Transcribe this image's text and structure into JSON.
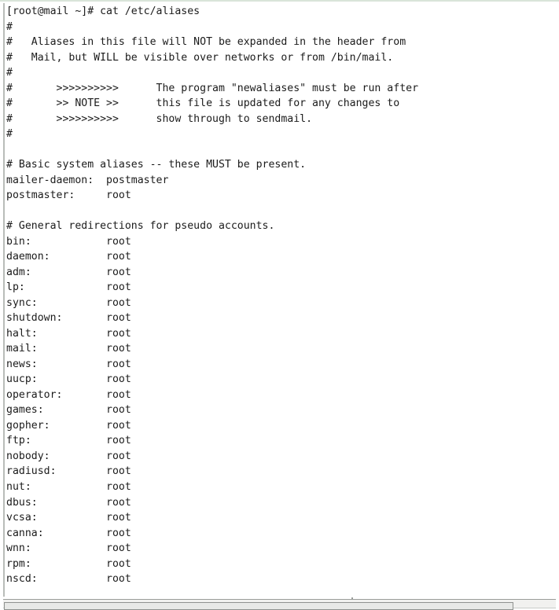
{
  "window": {
    "kind": "terminal-emulator",
    "background_color": "#ffffff",
    "foreground_color": "#1b1b1b",
    "border_color": "#b9bcb9",
    "top_border_color": "#d9e4d9"
  },
  "prompt": {
    "user": "root",
    "host": "mail",
    "cwd": "~",
    "symbol": "#",
    "full_prompt": "[root@mail ~]#",
    "command": "cat /etc/aliases",
    "full_line": "[root@mail ~]# cat /etc/aliases"
  },
  "file": {
    "path": "/etc/aliases",
    "alias_target_column": 16
  },
  "lines": [
    "[root@mail ~]# cat /etc/aliases",
    "#",
    "#   Aliases in this file will NOT be expanded in the header from",
    "#   Mail, but WILL be visible over networks or from /bin/mail.",
    "#",
    "#       >>>>>>>>>>      The program \"newaliases\" must be run after",
    "#       >> NOTE >>      this file is updated for any changes to",
    "#       >>>>>>>>>>      show through to sendmail.",
    "#",
    "",
    "# Basic system aliases -- these MUST be present.",
    "mailer-daemon:  postmaster",
    "postmaster:     root",
    "",
    "# General redirections for pseudo accounts.",
    "bin:            root",
    "daemon:         root",
    "adm:            root",
    "lp:             root",
    "sync:           root",
    "shutdown:       root",
    "halt:           root",
    "mail:           root",
    "news:           root",
    "uucp:           root",
    "operator:       root",
    "games:          root",
    "gopher:         root",
    "ftp:            root",
    "nobody:         root",
    "radiusd:        root",
    "nut:            root",
    "dbus:           root",
    "vcsa:           root",
    "canna:          root",
    "wnn:            root",
    "rpm:            root",
    "nscd:           root"
  ],
  "comments": {
    "header_block": [
      "Aliases in this file will NOT be expanded in the header from",
      "Mail, but WILL be visible over networks or from /bin/mail."
    ],
    "note_block": {
      "chevrons_top": ">>>>>>>>>>",
      "note_label": ">> NOTE >>",
      "chevrons_bottom": ">>>>>>>>>>",
      "text": [
        "The program \"newaliases\" must be run after",
        "this file is updated for any changes to",
        "show through to sendmail."
      ]
    },
    "basic_section": "# Basic system aliases -- these MUST be present.",
    "general_section": "# General redirections for pseudo accounts."
  },
  "aliases": [
    {
      "name": "mailer-daemon:",
      "target": "postmaster"
    },
    {
      "name": "postmaster:",
      "target": "root"
    },
    {
      "name": "bin:",
      "target": "root"
    },
    {
      "name": "daemon:",
      "target": "root"
    },
    {
      "name": "adm:",
      "target": "root"
    },
    {
      "name": "lp:",
      "target": "root"
    },
    {
      "name": "sync:",
      "target": "root"
    },
    {
      "name": "shutdown:",
      "target": "root"
    },
    {
      "name": "halt:",
      "target": "root"
    },
    {
      "name": "mail:",
      "target": "root"
    },
    {
      "name": "news:",
      "target": "root"
    },
    {
      "name": "uucp:",
      "target": "root"
    },
    {
      "name": "operator:",
      "target": "root"
    },
    {
      "name": "games:",
      "target": "root"
    },
    {
      "name": "gopher:",
      "target": "root"
    },
    {
      "name": "ftp:",
      "target": "root"
    },
    {
      "name": "nobody:",
      "target": "root"
    },
    {
      "name": "radiusd:",
      "target": "root"
    },
    {
      "name": "nut:",
      "target": "root"
    },
    {
      "name": "dbus:",
      "target": "root"
    },
    {
      "name": "vcsa:",
      "target": "root"
    },
    {
      "name": "canna:",
      "target": "root"
    },
    {
      "name": "wnn:",
      "target": "root"
    },
    {
      "name": "rpm:",
      "target": "root"
    },
    {
      "name": "nscd:",
      "target": "root"
    }
  ],
  "scrollbar": {
    "orientation": "horizontal",
    "thumb_color": "#e8e9e7",
    "trough_color": "#f1f1ef",
    "thumb_fraction": 0.92
  }
}
